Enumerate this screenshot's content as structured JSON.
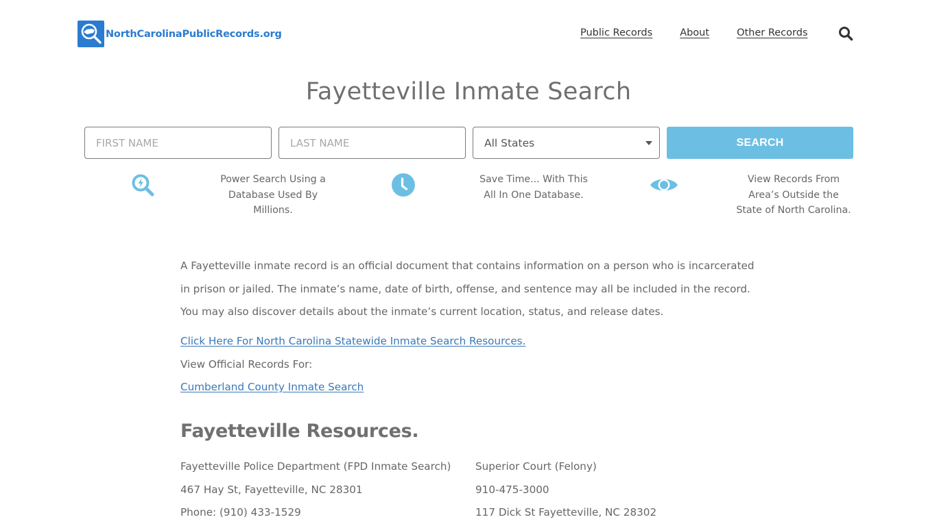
{
  "header": {
    "logo_text": "NorthCarolinaPublicRecords.org",
    "logo_icon": "magnifier-state-map-icon",
    "nav": [
      {
        "label": "Public Records"
      },
      {
        "label": "About"
      },
      {
        "label": "Other Records"
      }
    ],
    "search_icon": "search-icon"
  },
  "page_title": "Fayetteville Inmate Search",
  "search_form": {
    "first_name_placeholder": "FIRST NAME",
    "last_name_placeholder": "LAST NAME",
    "state_selected": "All States",
    "search_label": "SEARCH"
  },
  "features": [
    {
      "icon": "power-search-icon",
      "lines": [
        "Power Search Using a",
        "Database Used By",
        "Millions."
      ]
    },
    {
      "icon": "clock-icon",
      "lines": [
        "Save Time... With This",
        "All In One Database."
      ]
    },
    {
      "icon": "eye-icon",
      "lines": [
        "View Records From",
        "Area’s Outside the",
        "State of North Carolina."
      ]
    }
  ],
  "content": {
    "intro_lines": [
      "A Fayetteville inmate record is an official document that contains information on a person who is incarcerated",
      "in prison or jailed. The inmate’s name, date of birth, offense, and sentence may all be included in the record.",
      "You may also discover details about the inmate’s current location, status, and release dates."
    ],
    "statewide_link": "Click Here For North Carolina Statewide Inmate Search Resources.",
    "official_records_label": "View Official Records For:",
    "county_link": "Cumberland County Inmate Search"
  },
  "resources": {
    "title": "Fayetteville Resources.",
    "left": [
      "Fayetteville Police Department (FPD Inmate Search)",
      "467 Hay St, Fayetteville, NC 28301",
      "Phone: (910) 433-1529"
    ],
    "right": [
      "Superior Court (Felony)",
      "910-475-3000",
      "117 Dick St Fayetteville, NC 28302"
    ]
  },
  "colors": {
    "brand": "#2b7bd0",
    "accent": "#6cbfe3",
    "link": "#3a78b8",
    "text": "#666666"
  }
}
